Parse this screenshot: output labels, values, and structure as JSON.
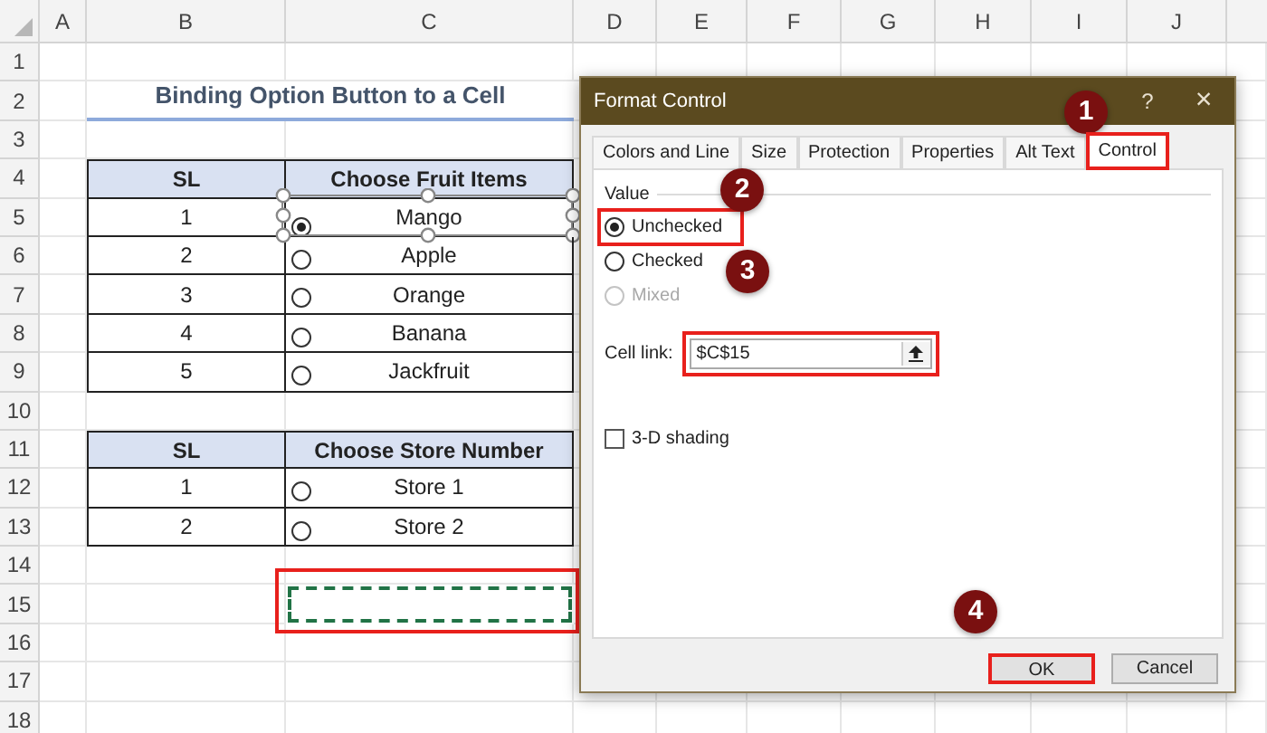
{
  "sheet": {
    "columns": [
      "A",
      "B",
      "C",
      "D",
      "E",
      "F",
      "G",
      "H",
      "I",
      "J"
    ],
    "rows": [
      "1",
      "2",
      "3",
      "4",
      "5",
      "6",
      "7",
      "8",
      "9",
      "10",
      "11",
      "12",
      "13",
      "14",
      "15",
      "16",
      "17",
      "18"
    ],
    "title": "Binding Option Button to a Cell",
    "tables": [
      {
        "headers": [
          "SL",
          "Choose Fruit Items"
        ],
        "rows": [
          {
            "sl": "1",
            "item": "Mango",
            "selected": true
          },
          {
            "sl": "2",
            "item": "Apple",
            "selected": false
          },
          {
            "sl": "3",
            "item": "Orange",
            "selected": false
          },
          {
            "sl": "4",
            "item": "Banana",
            "selected": false
          },
          {
            "sl": "5",
            "item": "Jackfruit",
            "selected": false
          }
        ]
      },
      {
        "headers": [
          "SL",
          "Choose Store Number"
        ],
        "rows": [
          {
            "sl": "1",
            "item": "Store 1",
            "selected": false
          },
          {
            "sl": "2",
            "item": "Store 2",
            "selected": false
          }
        ]
      }
    ],
    "linked_cell": {
      "highlighted": true
    }
  },
  "dialog": {
    "title": "Format Control",
    "help": "?",
    "close": "×",
    "tabs": [
      {
        "label": "Colors and Line",
        "selected": false
      },
      {
        "label": "Size",
        "selected": false
      },
      {
        "label": "Protection",
        "selected": false
      },
      {
        "label": "Properties",
        "selected": false
      },
      {
        "label": "Alt Text",
        "selected": false
      },
      {
        "label": "Control",
        "selected": true
      }
    ],
    "group_label": "Value",
    "options": [
      {
        "label": "Unchecked",
        "selected": true,
        "disabled": false
      },
      {
        "label": "Checked",
        "selected": false,
        "disabled": false
      },
      {
        "label": "Mixed",
        "selected": false,
        "disabled": true
      }
    ],
    "cell_link": {
      "label": "Cell link:",
      "value": "$C$15"
    },
    "shading": {
      "label": "3-D shading",
      "checked": false
    },
    "buttons": [
      {
        "label": "OK",
        "kind": "primary"
      },
      {
        "label": "Cancel",
        "kind": "secondary"
      }
    ]
  },
  "annotations": [
    "1",
    "2",
    "3",
    "4"
  ]
}
